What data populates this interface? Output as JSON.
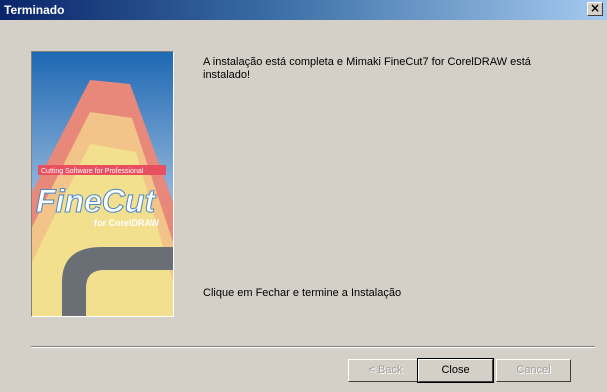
{
  "window": {
    "title": "Terminado",
    "close_glyph": "×"
  },
  "banner": {
    "tagline": "Cutting Software for Professional",
    "logo": "FineCut",
    "subtitle": "for CorelDRAW"
  },
  "message": {
    "top": "A instalação está completa e Mimaki FineCut7 for CorelDRAW está instalado!",
    "bottom": "Clique em Fechar e termine a Instalação"
  },
  "buttons": {
    "back": "< Back",
    "close": "Close",
    "cancel": "Cancel"
  }
}
